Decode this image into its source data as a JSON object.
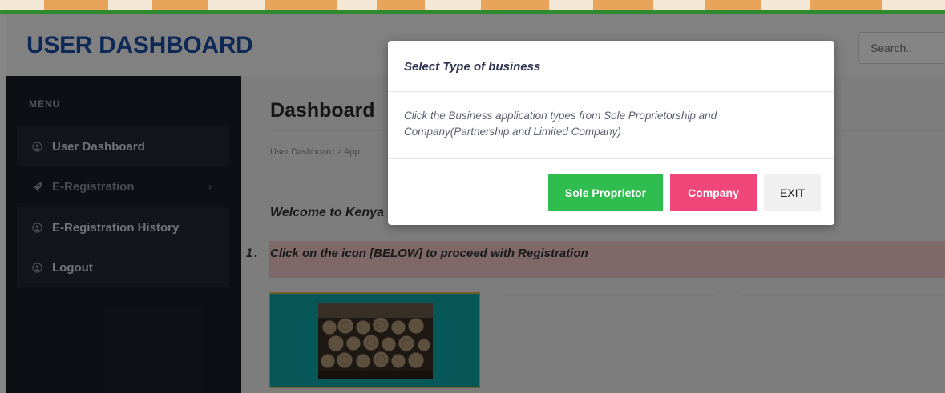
{
  "header": {
    "brand": "USER DASHBOARD",
    "search_placeholder": "Search.."
  },
  "sidebar": {
    "menu_label": "MENU",
    "items": [
      {
        "label": "User Dashboard",
        "icon": "user-icon"
      },
      {
        "label": "E-Registration",
        "icon": "rocket-icon",
        "has_submenu": true
      },
      {
        "label": "E-Registration History",
        "icon": "user-icon"
      },
      {
        "label": "Logout",
        "icon": "user-icon"
      }
    ]
  },
  "main": {
    "title": "Dashboard",
    "breadcrumb": "User Dashboard  >  App",
    "welcome": "Welcome to Kenya",
    "notice_number": "1.",
    "notice_text": "Click on the icon [BELOW] to proceed with Registration"
  },
  "modal": {
    "title": "Select Type of business",
    "body": "Click the Business application types from Sole Proprietorship and Company(Partnership and Limited Company)",
    "buttons": {
      "sole": "Sole Proprietor",
      "company": "Company",
      "exit": "EXIT"
    }
  },
  "colors": {
    "brand": "#1e4fa8",
    "sidebar_bg": "#1c1d2a",
    "sole_button": "#2fbd4f",
    "company_button": "#f0477a",
    "tile_bg": "#0ea5a9",
    "notice_bg": "#f4c8c8"
  }
}
